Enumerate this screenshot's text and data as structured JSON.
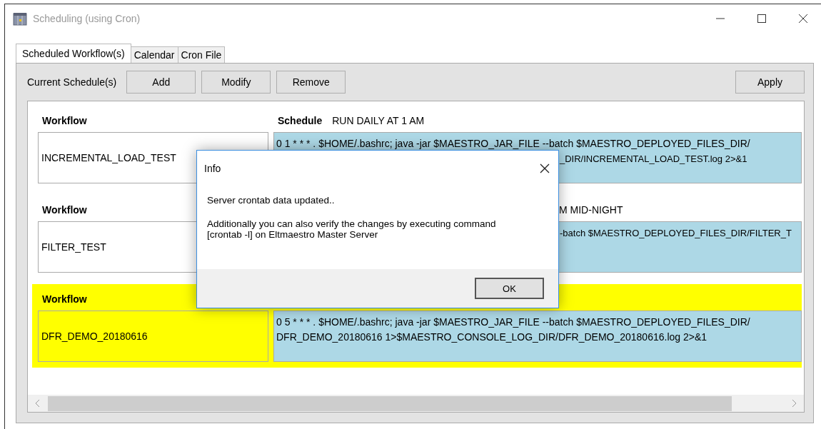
{
  "window": {
    "title": "Scheduling (using Cron)"
  },
  "tabs": [
    {
      "label": "Scheduled Workflow(s)",
      "selected": true
    },
    {
      "label": "Calendar",
      "selected": false
    },
    {
      "label": "Cron File",
      "selected": false
    }
  ],
  "toolbar": {
    "label": "Current Schedule(s)",
    "buttons": [
      "Add",
      "Modify",
      "Remove"
    ],
    "apply": "Apply"
  },
  "schedules": [
    {
      "selected": false,
      "workflow_label": "Workflow",
      "workflow": "INCREMENTAL_LOAD_TEST",
      "schedule_label": "Schedule",
      "schedule": "RUN DAILY AT 1 AM",
      "schedule_covered": false,
      "command": [
        {
          "text": "0 1 * * * . $HOME/.bashrc; java -jar $MAESTRO_JAR_FILE --batch $MAESTRO_DEPLOYED_FILES_DIR/",
          "covered": false
        },
        {
          "text": "_DIR/INCREMENTAL_LOAD_TEST.log 2>&1",
          "covered": true
        }
      ]
    },
    {
      "selected": false,
      "workflow_label": "Workflow",
      "workflow": "FILTER_TEST",
      "schedule": "M MID-NIGHT",
      "schedule_covered": true,
      "command": [
        {
          "text": "-batch $MAESTRO_DEPLOYED_FILES_DIR/FILTER_T",
          "covered": true
        }
      ]
    },
    {
      "selected": true,
      "workflow_label": "Workflow",
      "workflow": "DFR_DEMO_20180616",
      "command": [
        {
          "text": "0 5 * * * . $HOME/.bashrc; java -jar $MAESTRO_JAR_FILE --batch $MAESTRO_DEPLOYED_FILES_DIR/",
          "covered": false
        },
        {
          "text": "DFR_DEMO_20180616 1>$MAESTRO_CONSOLE_LOG_DIR/DFR_DEMO_20180616.log 2>&1",
          "covered": false
        }
      ]
    }
  ],
  "dialog": {
    "title": "Info",
    "message": "Server crontab data updated..",
    "detail": "Additionally you can also verify the changes by executing command [crontab -l] on Eltmaestro Master Server",
    "ok": "OK"
  }
}
